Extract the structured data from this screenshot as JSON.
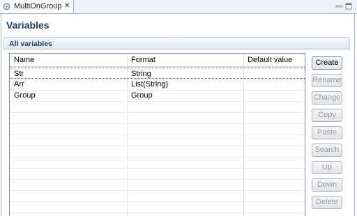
{
  "tab": {
    "title": "MultiOnGroup",
    "close_glyph": "✕"
  },
  "page": {
    "title": "Variables"
  },
  "section": {
    "title": "All variables"
  },
  "table": {
    "columns": [
      "Name",
      "Format",
      "Default value"
    ],
    "rows": [
      {
        "name": "Str",
        "format": "String",
        "default": ""
      },
      {
        "name": "Arr",
        "format": "List(String)",
        "default": ""
      },
      {
        "name": "Group",
        "format": "Group",
        "default": ""
      }
    ]
  },
  "buttons": {
    "create": "Create",
    "rename": "Rename",
    "change": "Change",
    "copy": "Copy",
    "paste": "Paste",
    "search": "Search",
    "up": "Up",
    "down": "Down",
    "delete": "Delete"
  },
  "colors": {
    "accent": "#1d3d62",
    "border": "#9fb4cf"
  }
}
